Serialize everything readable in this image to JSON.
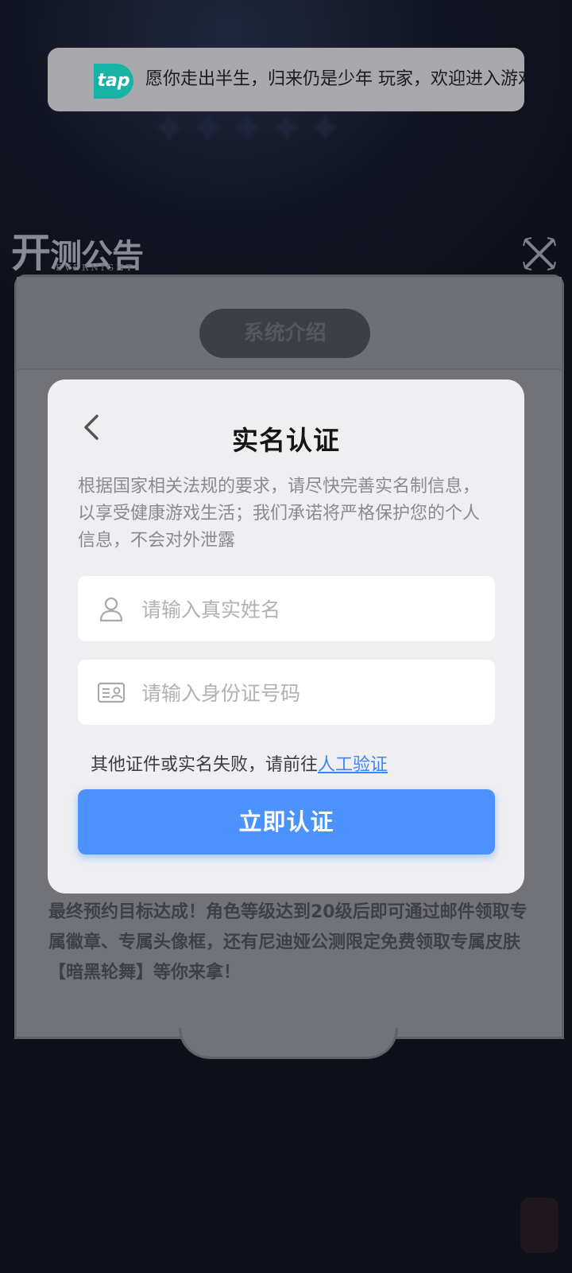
{
  "toast": {
    "logo_text": "tap",
    "message": "愿你走出半生，归来仍是少年 玩家，欢迎进入游戏"
  },
  "background": {
    "notice_heading_big": "开",
    "notice_heading_rest": "测公告",
    "notice_subtitle": "EVERNIGHT",
    "tab_label": "系统介绍",
    "panel_text": "最终预约目标达成！角色等级达到20级后即可通过邮件领取专属徽章、专属头像框，还有尼迪娅公测限定免费领取专属皮肤【暗黑轮舞】等你来拿！"
  },
  "modal": {
    "title": "实名认证",
    "description": "根据国家相关法规的要求，请尽快完善实名制信息，以享受健康游戏生活；我们承诺将严格保护您的个人信息，不会对外泄露",
    "name_placeholder": "请输入真实姓名",
    "id_placeholder": "请输入身份证号码",
    "alt_prefix": "其他证件或实名失败，请前往",
    "alt_link": "人工验证",
    "submit_label": "立即认证"
  },
  "colors": {
    "primary": "#4b92fd",
    "link": "#3d84f7",
    "tap_brand": "#17b3a4"
  }
}
